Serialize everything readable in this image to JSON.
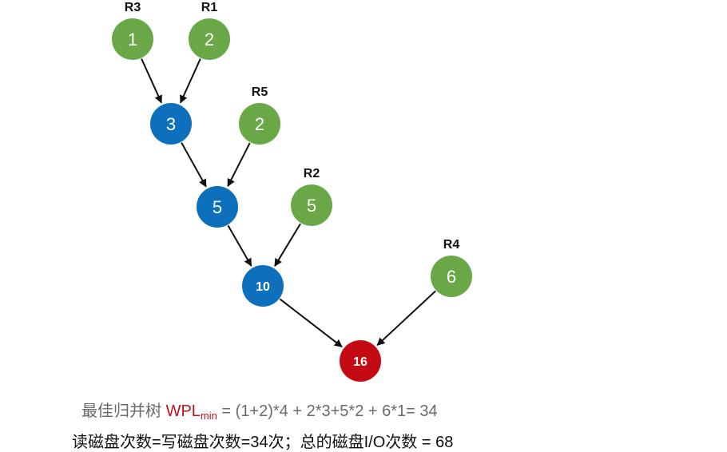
{
  "colors": {
    "leaf": "#6aa847",
    "internal": "#0e6fbd",
    "root": "#c40b13",
    "edge": "#111111"
  },
  "tree": {
    "nodes": [
      {
        "id": "n1",
        "value": "1",
        "label": "R3",
        "kind": "leaf"
      },
      {
        "id": "n2",
        "value": "2",
        "label": "R1",
        "kind": "leaf"
      },
      {
        "id": "n3",
        "value": "3",
        "label": "",
        "kind": "internal"
      },
      {
        "id": "n4",
        "value": "2",
        "label": "R5",
        "kind": "leaf"
      },
      {
        "id": "n5",
        "value": "5",
        "label": "",
        "kind": "internal"
      },
      {
        "id": "n6",
        "value": "5",
        "label": "R2",
        "kind": "leaf"
      },
      {
        "id": "n7",
        "value": "10",
        "label": "",
        "kind": "internal"
      },
      {
        "id": "n8",
        "value": "6",
        "label": "R4",
        "kind": "leaf"
      },
      {
        "id": "n9",
        "value": "16",
        "label": "",
        "kind": "root"
      }
    ],
    "edges": [
      [
        "n1",
        "n3"
      ],
      [
        "n2",
        "n3"
      ],
      [
        "n3",
        "n5"
      ],
      [
        "n4",
        "n5"
      ],
      [
        "n5",
        "n7"
      ],
      [
        "n6",
        "n7"
      ],
      [
        "n7",
        "n9"
      ],
      [
        "n8",
        "n9"
      ]
    ]
  },
  "formula": {
    "prefix": "最佳归并树 ",
    "wpl": "WPL",
    "wpl_sub": "min",
    "expression": " = (1+2)*4 + 2*3+5*2 + 6*1= 34"
  },
  "io_text": "读磁盘次数=写磁盘次数=34次；总的磁盘I/O次数 = 68"
}
